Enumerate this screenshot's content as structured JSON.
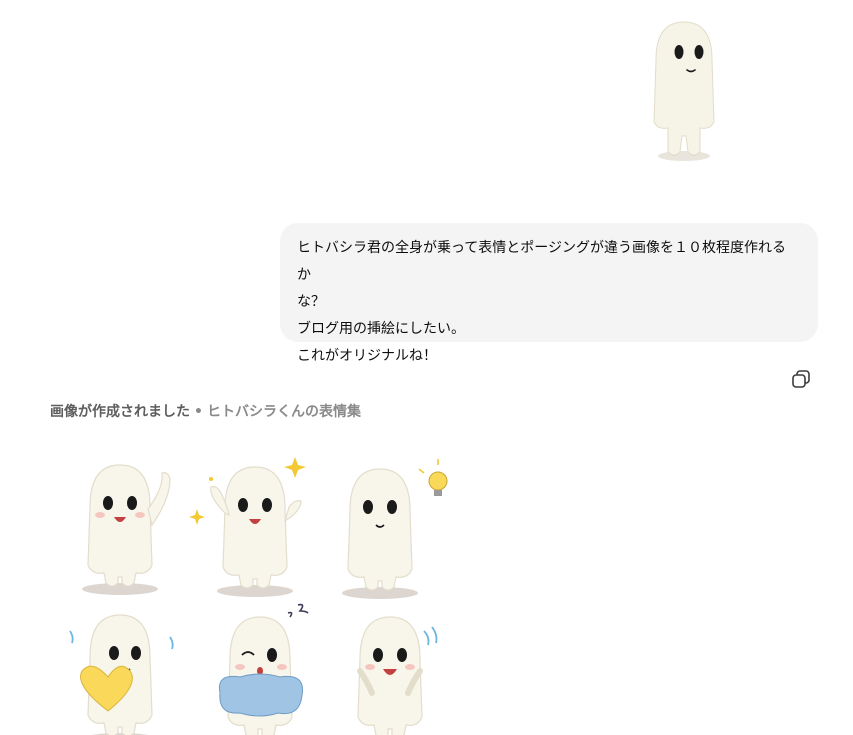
{
  "chat": {
    "user_attachment": {
      "icon": "ghost-character-image",
      "alt": "original character"
    },
    "user_message": {
      "lines": [
        "ヒトバシラ君の全身が乗って表情とポージングが違う画像を１０枚程度作れるか",
        "な？",
        "ブログ用の挿絵にしたい。",
        "これがオリジナルね！"
      ]
    },
    "copy_icon": "copy-icon",
    "assistant": {
      "status": "画像が作成されました",
      "separator": "•",
      "image_title": "ヒトバシラくんの表情集"
    }
  },
  "colors": {
    "bubble_bg": "#f4f4f4",
    "character_body": "#f8f5e8",
    "shadow": "#d8cfc8",
    "heart": "#f9d85a",
    "pillow": "#9fc4e4",
    "sparkle": "#f2c933"
  }
}
